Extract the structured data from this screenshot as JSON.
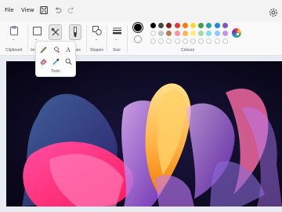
{
  "menu": {
    "file": "File",
    "view": "View"
  },
  "groups": {
    "clipboard": "Clipboard",
    "image": "Im",
    "brushes": "hes",
    "shapes": "Shapes",
    "size": "Size",
    "colours": "Colours"
  },
  "tools_popup": {
    "label": "Tools"
  },
  "icons": {
    "save": "save-icon",
    "undo": "undo-icon",
    "redo": "redo-icon",
    "settings": "settings-icon",
    "clipboard": "clipboard-icon",
    "selection": "selection-icon",
    "tools": "tools-icon",
    "brushes": "brush-icon",
    "shapes": "shapes-icon",
    "size": "size-icon",
    "pencil": "pencil-icon",
    "fill": "fill-icon",
    "text": "text-icon",
    "eraser": "eraser-icon",
    "picker": "color-picker-icon",
    "magnifier": "magnifier-icon",
    "edit_colours": "edit-colours-icon"
  },
  "colours": {
    "primary": "#000000",
    "secondary": "#ffffff",
    "palette_row1": [
      "#000000",
      "#464646",
      "#8b1a1a",
      "#e53935",
      "#f57c00",
      "#fdd835",
      "#43a047",
      "#26a69a",
      "#1e88e5",
      "#7e57c2"
    ],
    "palette_row2": [
      "#ffffff",
      "#c3c3c3",
      "#b97a57",
      "#ff8fa3",
      "#ffb74d",
      "#fff176",
      "#a5d6a7",
      "#80deea",
      "#90caf9",
      "#ce93d8"
    ]
  }
}
